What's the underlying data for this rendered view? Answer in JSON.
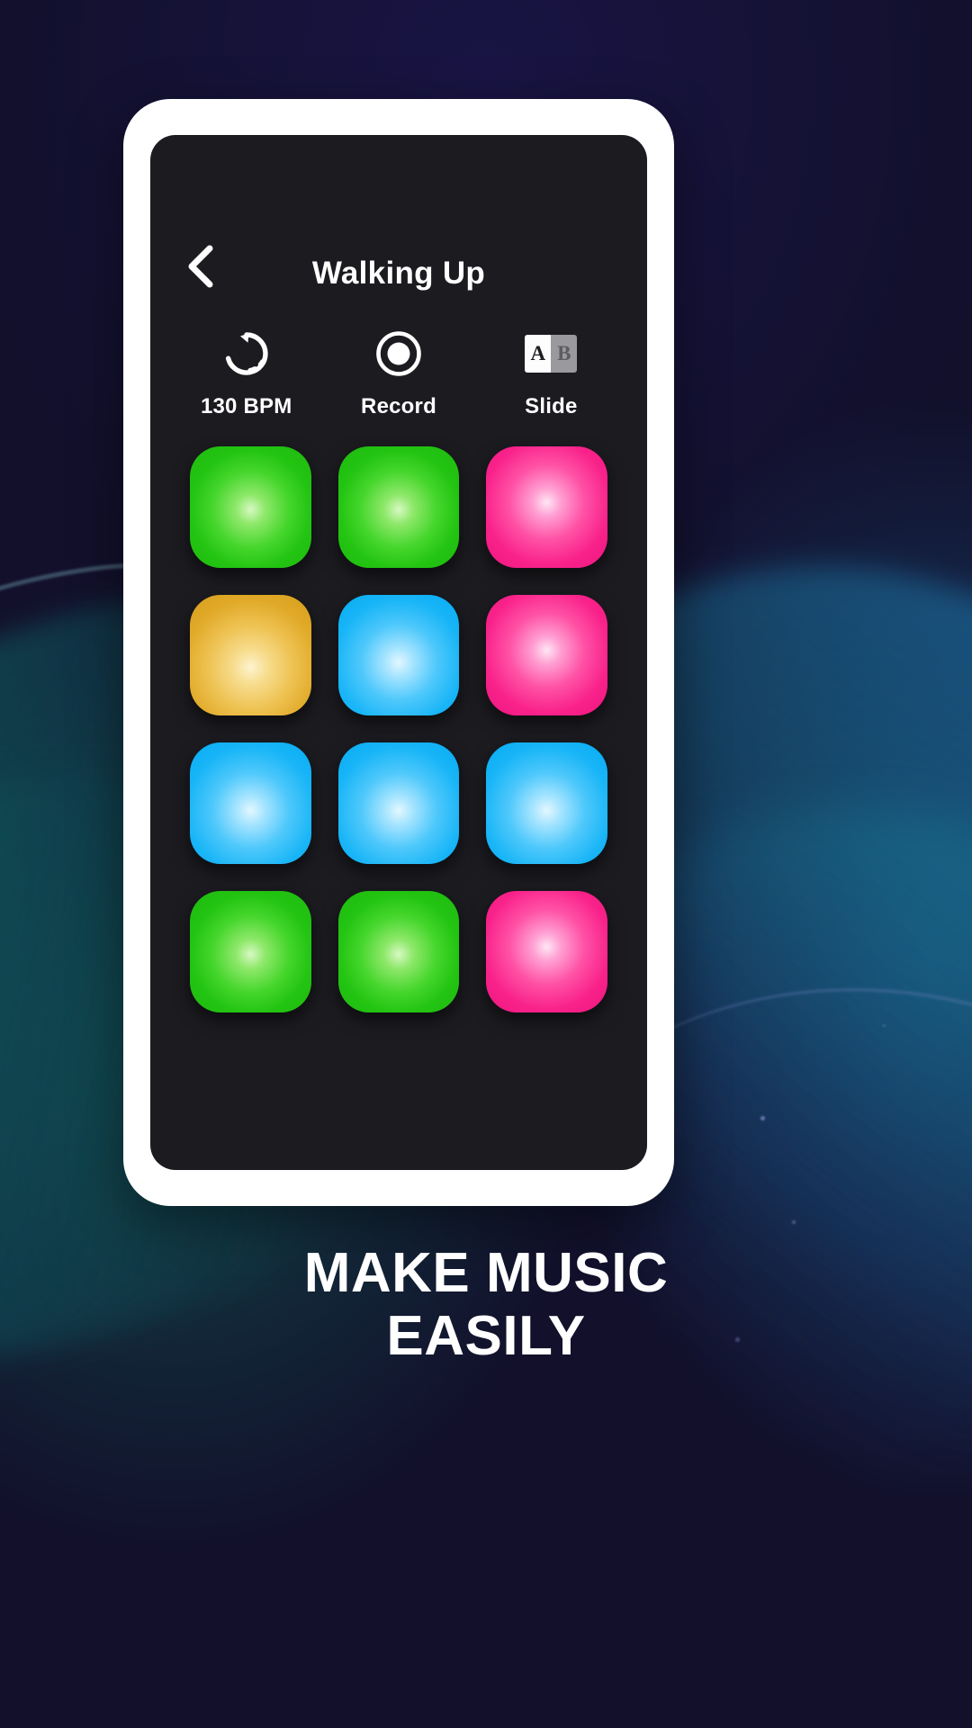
{
  "background": {
    "base_color": "#14112e",
    "accent_teal": "#0c8468",
    "accent_blue": "#1e6ea5"
  },
  "device": {
    "frame_color": "#ffffff",
    "screen_color": "#1b1b20"
  },
  "app": {
    "header": {
      "back_icon": "chevron-left-icon",
      "title": "Walking Up"
    },
    "toolbar": [
      {
        "id": "bpm",
        "icon": "loop-refresh-icon",
        "label": "130 BPM"
      },
      {
        "id": "record",
        "icon": "record-circle-icon",
        "label": "Record"
      },
      {
        "id": "slide",
        "icon": "ab-slide-icon",
        "label": "Slide",
        "cell_a": "A",
        "cell_b": "B"
      }
    ],
    "pad_grid": {
      "rows": 4,
      "columns": 3,
      "pads": [
        {
          "index": 1,
          "color_name": "green",
          "color": "#23c412"
        },
        {
          "index": 2,
          "color_name": "green",
          "color": "#23c412"
        },
        {
          "index": 3,
          "color_name": "pink",
          "color": "#f9228a"
        },
        {
          "index": 4,
          "color_name": "gold",
          "color": "#e0a927"
        },
        {
          "index": 5,
          "color_name": "blue",
          "color": "#18b5f7"
        },
        {
          "index": 6,
          "color_name": "pink",
          "color": "#f9228a"
        },
        {
          "index": 7,
          "color_name": "blue",
          "color": "#18b5f7"
        },
        {
          "index": 8,
          "color_name": "blue",
          "color": "#18b5f7"
        },
        {
          "index": 9,
          "color_name": "blue",
          "color": "#18b5f7"
        },
        {
          "index": 10,
          "color_name": "green",
          "color": "#23c412"
        },
        {
          "index": 11,
          "color_name": "green",
          "color": "#23c412"
        },
        {
          "index": 12,
          "color_name": "pink",
          "color": "#f9228a"
        }
      ]
    }
  },
  "caption": {
    "line1": "MAKE MUSIC",
    "line2": "EASILY"
  }
}
